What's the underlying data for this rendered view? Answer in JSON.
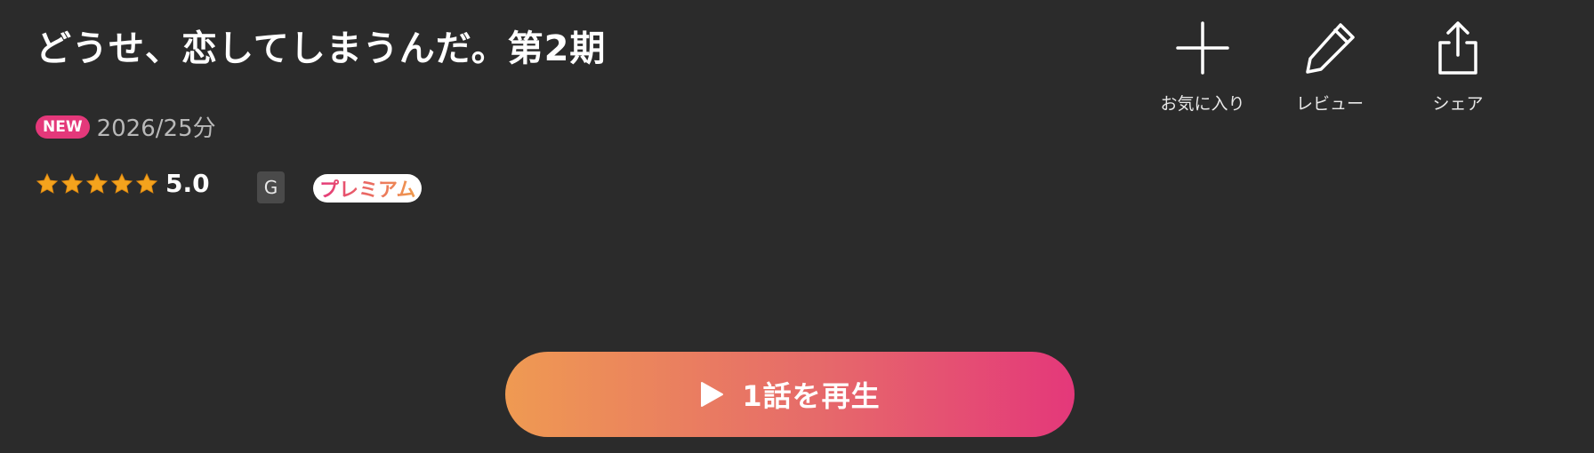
{
  "title": "どうせ、恋してしまうんだ。第2期",
  "meta": {
    "new_badge": "NEW",
    "text": "2026/25分"
  },
  "rating": {
    "stars": 5,
    "max_stars": 5,
    "value": "5.0"
  },
  "age_rating": "G",
  "premium_badge": "プレミアム",
  "actions": [
    {
      "label": "お気に入り",
      "icon": "plus-icon"
    },
    {
      "label": "レビュー",
      "icon": "pencil-icon"
    },
    {
      "label": "シェア",
      "icon": "share-icon"
    }
  ],
  "play_button": {
    "label": "1話を再生",
    "icon": "play-icon"
  },
  "colors": {
    "background": "#2b2b2b",
    "accent_pink": "#e4387a",
    "accent_orange": "#ef9a52",
    "star": "#f4a31d"
  }
}
